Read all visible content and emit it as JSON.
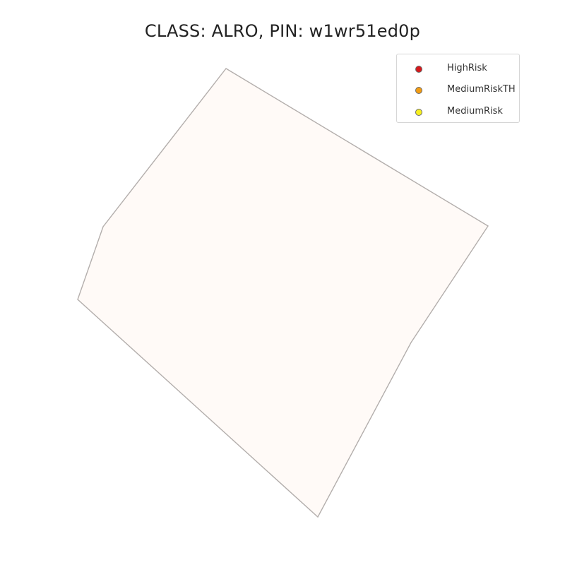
{
  "title": "CLASS: ALRO, PIN: w1wr51ed0p",
  "parcel": {
    "fill": "#fffaf7",
    "stroke": "#b3aeac"
  },
  "legend": {
    "items": [
      {
        "label": "HighRisk",
        "color": "#d7191c"
      },
      {
        "label": "MediumRiskTH",
        "color": "#f39c12"
      },
      {
        "label": "MediumRisk",
        "color": "#f7f01f"
      }
    ]
  }
}
